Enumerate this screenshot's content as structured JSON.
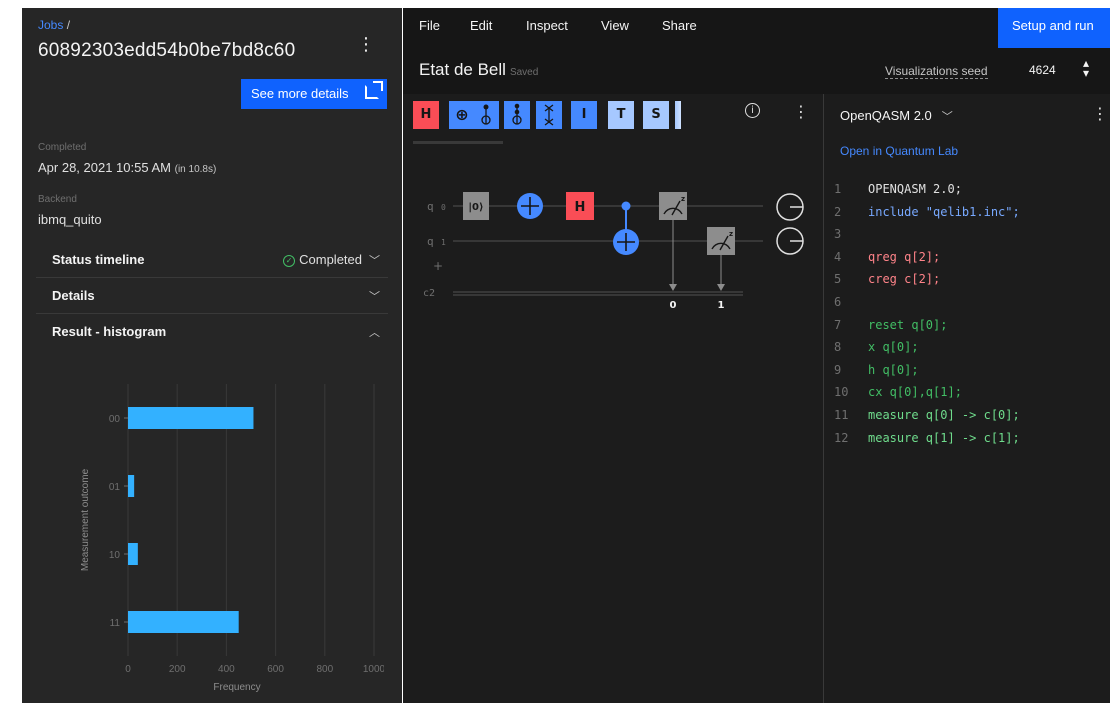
{
  "left": {
    "breadcrumb": "Jobs",
    "breadcrumb_sep": "/",
    "job_id": "60892303edd54b0be7bd8c60",
    "kebab": "⋮",
    "details_button": "See more details",
    "completed_label": "Completed",
    "completed_value": "Apr 28, 2021 10:55 AM",
    "completed_duration": "(in 10.8s)",
    "backend_label": "Backend",
    "backend_value": "ibmq_quito",
    "sections": [
      {
        "title": "Status timeline",
        "status": "Completed",
        "expanded": false
      },
      {
        "title": "Details",
        "expanded": false
      },
      {
        "title": "Result - histogram",
        "expanded": true
      }
    ]
  },
  "chart_data": {
    "type": "bar",
    "orientation": "horizontal",
    "categories": [
      "00",
      "01",
      "10",
      "11"
    ],
    "values": [
      510,
      25,
      40,
      450
    ],
    "xlabel": "Frequency",
    "ylabel": "Measurement outcome",
    "xlim": [
      0,
      1000
    ],
    "xticks": [
      0,
      200,
      400,
      600,
      800,
      1000
    ],
    "grid": true,
    "colors": {
      "bar": "#33b1ff",
      "grid": "#393939",
      "axis_text": "#6f6f6f"
    }
  },
  "topbar": {
    "menus": [
      "File",
      "Edit",
      "Inspect",
      "View",
      "Share"
    ],
    "setup_button": "Setup and run"
  },
  "circuit_header": {
    "title": "Etat de Bell",
    "saved": "Saved",
    "seed_label": "Visualizations seed",
    "seed_value": "4624"
  },
  "palette": {
    "gates": [
      "H",
      "⊕",
      "",
      "",
      "",
      "I",
      "T",
      "S"
    ],
    "info": "i"
  },
  "circuit": {
    "wires": [
      "q",
      "q",
      "c2"
    ],
    "wire_indices": [
      "0",
      "1"
    ],
    "reset_label": "|0⟩",
    "h_label": "H",
    "measure_targets": [
      "0",
      "1"
    ],
    "measure_basis": "z"
  },
  "code": {
    "language": "OpenQASM 2.0",
    "open_lab": "Open in Quantum Lab",
    "lines": [
      "OPENQASM 2.0;",
      "include \"qelib1.inc\";",
      "",
      "qreg q[2];",
      "creg c[2];",
      "",
      "reset q[0];",
      "x q[0];",
      "h q[0];",
      "cx q[0],q[1];",
      "measure q[0] -> c[0];",
      "measure q[1] -> c[1];"
    ]
  },
  "colors": {
    "panel": "#262626",
    "background": "#161616",
    "accent": "#0f62fe",
    "gate_red": "#fa4d56",
    "gate_blue": "#4589ff",
    "success": "#42be65"
  }
}
